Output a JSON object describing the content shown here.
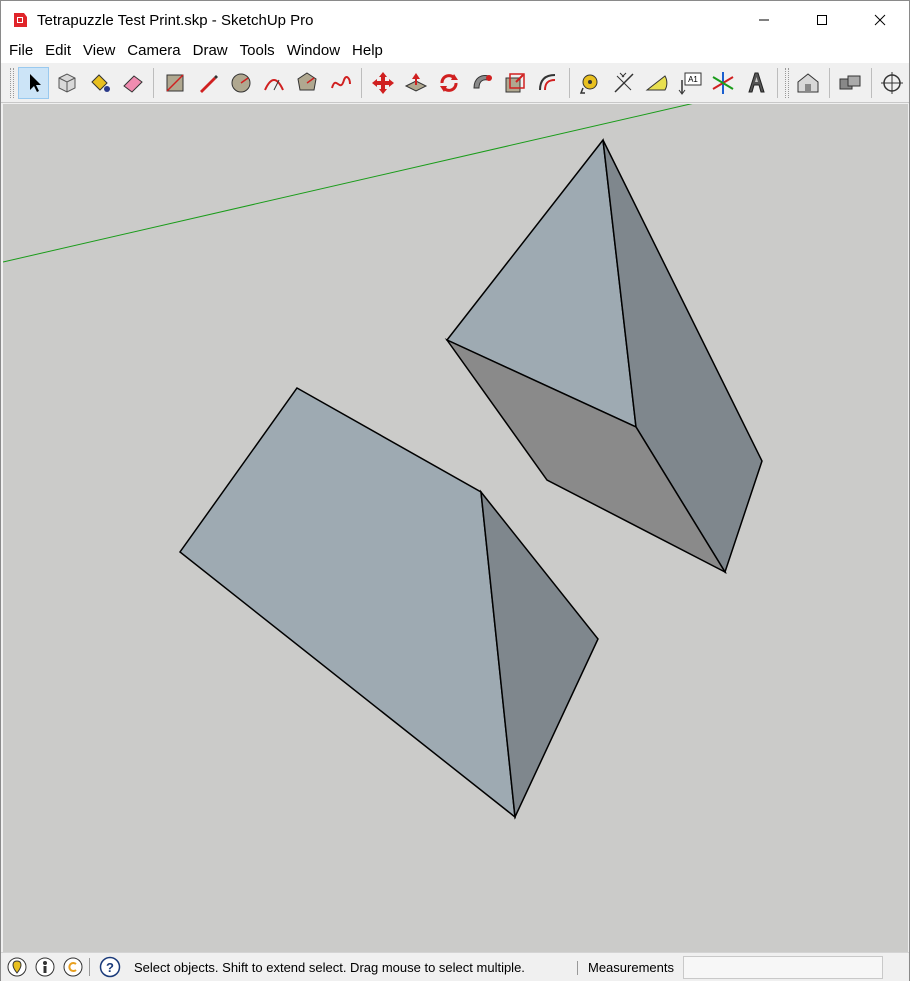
{
  "window": {
    "title": "Tetrapuzzle Test Print.skp - SketchUp Pro"
  },
  "menu": [
    {
      "label": "File"
    },
    {
      "label": "Edit"
    },
    {
      "label": "View"
    },
    {
      "label": "Camera"
    },
    {
      "label": "Draw"
    },
    {
      "label": "Tools"
    },
    {
      "label": "Window"
    },
    {
      "label": "Help"
    }
  ],
  "toolbar": {
    "tools": [
      "select-icon",
      "make-component-icon",
      "paint-bucket-icon",
      "eraser-icon",
      "rectangle-icon",
      "line-icon",
      "circle-icon",
      "arc-icon",
      "polygon-icon",
      "freehand-icon",
      "move-icon",
      "push-pull-icon",
      "rotate-icon",
      "follow-me-icon",
      "scale-icon",
      "offset-icon",
      "tape-measure-icon",
      "dimension-icon",
      "protractor-icon",
      "text-icon",
      "axes-icon",
      "3d-text-icon",
      "warehouse-icon",
      "extension-icon",
      "position-camera-icon"
    ],
    "text_tool_label": "A1"
  },
  "status": {
    "message": "Select objects. Shift to extend select. Drag mouse to select multiple.",
    "measurements_label": "Measurements",
    "measurements_value": ""
  },
  "colors": {
    "canvas_bg": "#cbcbc9",
    "face_light": "#9eaab2",
    "face_dark": "#7f878d",
    "face_bottom": "#8a8a8a",
    "axis_green": "#1a9c1a",
    "active_tool": "#cce4f7"
  }
}
